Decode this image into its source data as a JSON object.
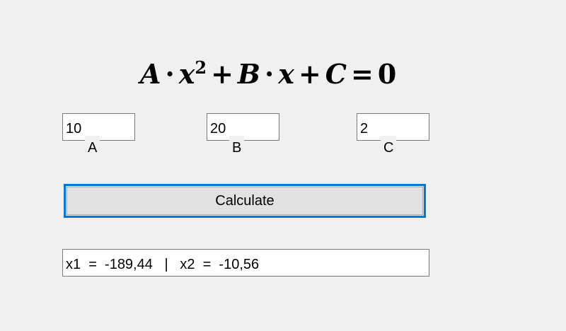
{
  "formula": {
    "a": "A",
    "dot1": "·",
    "x1": "x",
    "exp": "2",
    "plus1": "+",
    "b": "B",
    "dot2": "·",
    "x2": "x",
    "plus2": "+",
    "c": "C",
    "eq": "=",
    "zero": "0"
  },
  "inputs": {
    "a": {
      "value": "10",
      "label": "A"
    },
    "b": {
      "value": "20",
      "label": "B"
    },
    "c": {
      "value": "2",
      "label": "C"
    }
  },
  "calculate_button": {
    "label": "Calculate"
  },
  "result": {
    "value": "x1  =  -189,44   |   x2  =  -10,56"
  },
  "colors": {
    "background": "#f0f0f0",
    "button_focus_border": "#0078d7",
    "button_face": "#e1e1e1",
    "input_border": "#7a7a7a"
  }
}
